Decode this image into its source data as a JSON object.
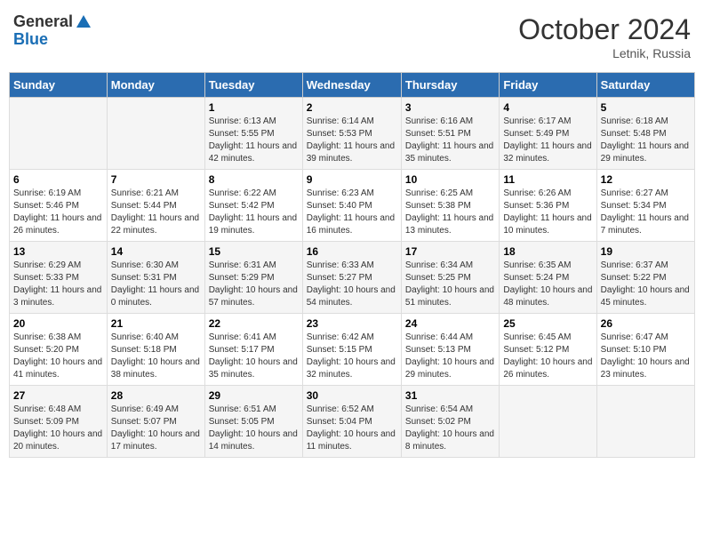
{
  "header": {
    "logo_general": "General",
    "logo_blue": "Blue",
    "month_title": "October 2024",
    "location": "Letnik, Russia"
  },
  "calendar": {
    "days_of_week": [
      "Sunday",
      "Monday",
      "Tuesday",
      "Wednesday",
      "Thursday",
      "Friday",
      "Saturday"
    ],
    "weeks": [
      [
        {
          "day": "",
          "info": ""
        },
        {
          "day": "",
          "info": ""
        },
        {
          "day": "1",
          "info": "Sunrise: 6:13 AM\nSunset: 5:55 PM\nDaylight: 11 hours and 42 minutes."
        },
        {
          "day": "2",
          "info": "Sunrise: 6:14 AM\nSunset: 5:53 PM\nDaylight: 11 hours and 39 minutes."
        },
        {
          "day": "3",
          "info": "Sunrise: 6:16 AM\nSunset: 5:51 PM\nDaylight: 11 hours and 35 minutes."
        },
        {
          "day": "4",
          "info": "Sunrise: 6:17 AM\nSunset: 5:49 PM\nDaylight: 11 hours and 32 minutes."
        },
        {
          "day": "5",
          "info": "Sunrise: 6:18 AM\nSunset: 5:48 PM\nDaylight: 11 hours and 29 minutes."
        }
      ],
      [
        {
          "day": "6",
          "info": "Sunrise: 6:19 AM\nSunset: 5:46 PM\nDaylight: 11 hours and 26 minutes."
        },
        {
          "day": "7",
          "info": "Sunrise: 6:21 AM\nSunset: 5:44 PM\nDaylight: 11 hours and 22 minutes."
        },
        {
          "day": "8",
          "info": "Sunrise: 6:22 AM\nSunset: 5:42 PM\nDaylight: 11 hours and 19 minutes."
        },
        {
          "day": "9",
          "info": "Sunrise: 6:23 AM\nSunset: 5:40 PM\nDaylight: 11 hours and 16 minutes."
        },
        {
          "day": "10",
          "info": "Sunrise: 6:25 AM\nSunset: 5:38 PM\nDaylight: 11 hours and 13 minutes."
        },
        {
          "day": "11",
          "info": "Sunrise: 6:26 AM\nSunset: 5:36 PM\nDaylight: 11 hours and 10 minutes."
        },
        {
          "day": "12",
          "info": "Sunrise: 6:27 AM\nSunset: 5:34 PM\nDaylight: 11 hours and 7 minutes."
        }
      ],
      [
        {
          "day": "13",
          "info": "Sunrise: 6:29 AM\nSunset: 5:33 PM\nDaylight: 11 hours and 3 minutes."
        },
        {
          "day": "14",
          "info": "Sunrise: 6:30 AM\nSunset: 5:31 PM\nDaylight: 11 hours and 0 minutes."
        },
        {
          "day": "15",
          "info": "Sunrise: 6:31 AM\nSunset: 5:29 PM\nDaylight: 10 hours and 57 minutes."
        },
        {
          "day": "16",
          "info": "Sunrise: 6:33 AM\nSunset: 5:27 PM\nDaylight: 10 hours and 54 minutes."
        },
        {
          "day": "17",
          "info": "Sunrise: 6:34 AM\nSunset: 5:25 PM\nDaylight: 10 hours and 51 minutes."
        },
        {
          "day": "18",
          "info": "Sunrise: 6:35 AM\nSunset: 5:24 PM\nDaylight: 10 hours and 48 minutes."
        },
        {
          "day": "19",
          "info": "Sunrise: 6:37 AM\nSunset: 5:22 PM\nDaylight: 10 hours and 45 minutes."
        }
      ],
      [
        {
          "day": "20",
          "info": "Sunrise: 6:38 AM\nSunset: 5:20 PM\nDaylight: 10 hours and 41 minutes."
        },
        {
          "day": "21",
          "info": "Sunrise: 6:40 AM\nSunset: 5:18 PM\nDaylight: 10 hours and 38 minutes."
        },
        {
          "day": "22",
          "info": "Sunrise: 6:41 AM\nSunset: 5:17 PM\nDaylight: 10 hours and 35 minutes."
        },
        {
          "day": "23",
          "info": "Sunrise: 6:42 AM\nSunset: 5:15 PM\nDaylight: 10 hours and 32 minutes."
        },
        {
          "day": "24",
          "info": "Sunrise: 6:44 AM\nSunset: 5:13 PM\nDaylight: 10 hours and 29 minutes."
        },
        {
          "day": "25",
          "info": "Sunrise: 6:45 AM\nSunset: 5:12 PM\nDaylight: 10 hours and 26 minutes."
        },
        {
          "day": "26",
          "info": "Sunrise: 6:47 AM\nSunset: 5:10 PM\nDaylight: 10 hours and 23 minutes."
        }
      ],
      [
        {
          "day": "27",
          "info": "Sunrise: 6:48 AM\nSunset: 5:09 PM\nDaylight: 10 hours and 20 minutes."
        },
        {
          "day": "28",
          "info": "Sunrise: 6:49 AM\nSunset: 5:07 PM\nDaylight: 10 hours and 17 minutes."
        },
        {
          "day": "29",
          "info": "Sunrise: 6:51 AM\nSunset: 5:05 PM\nDaylight: 10 hours and 14 minutes."
        },
        {
          "day": "30",
          "info": "Sunrise: 6:52 AM\nSunset: 5:04 PM\nDaylight: 10 hours and 11 minutes."
        },
        {
          "day": "31",
          "info": "Sunrise: 6:54 AM\nSunset: 5:02 PM\nDaylight: 10 hours and 8 minutes."
        },
        {
          "day": "",
          "info": ""
        },
        {
          "day": "",
          "info": ""
        }
      ]
    ]
  }
}
